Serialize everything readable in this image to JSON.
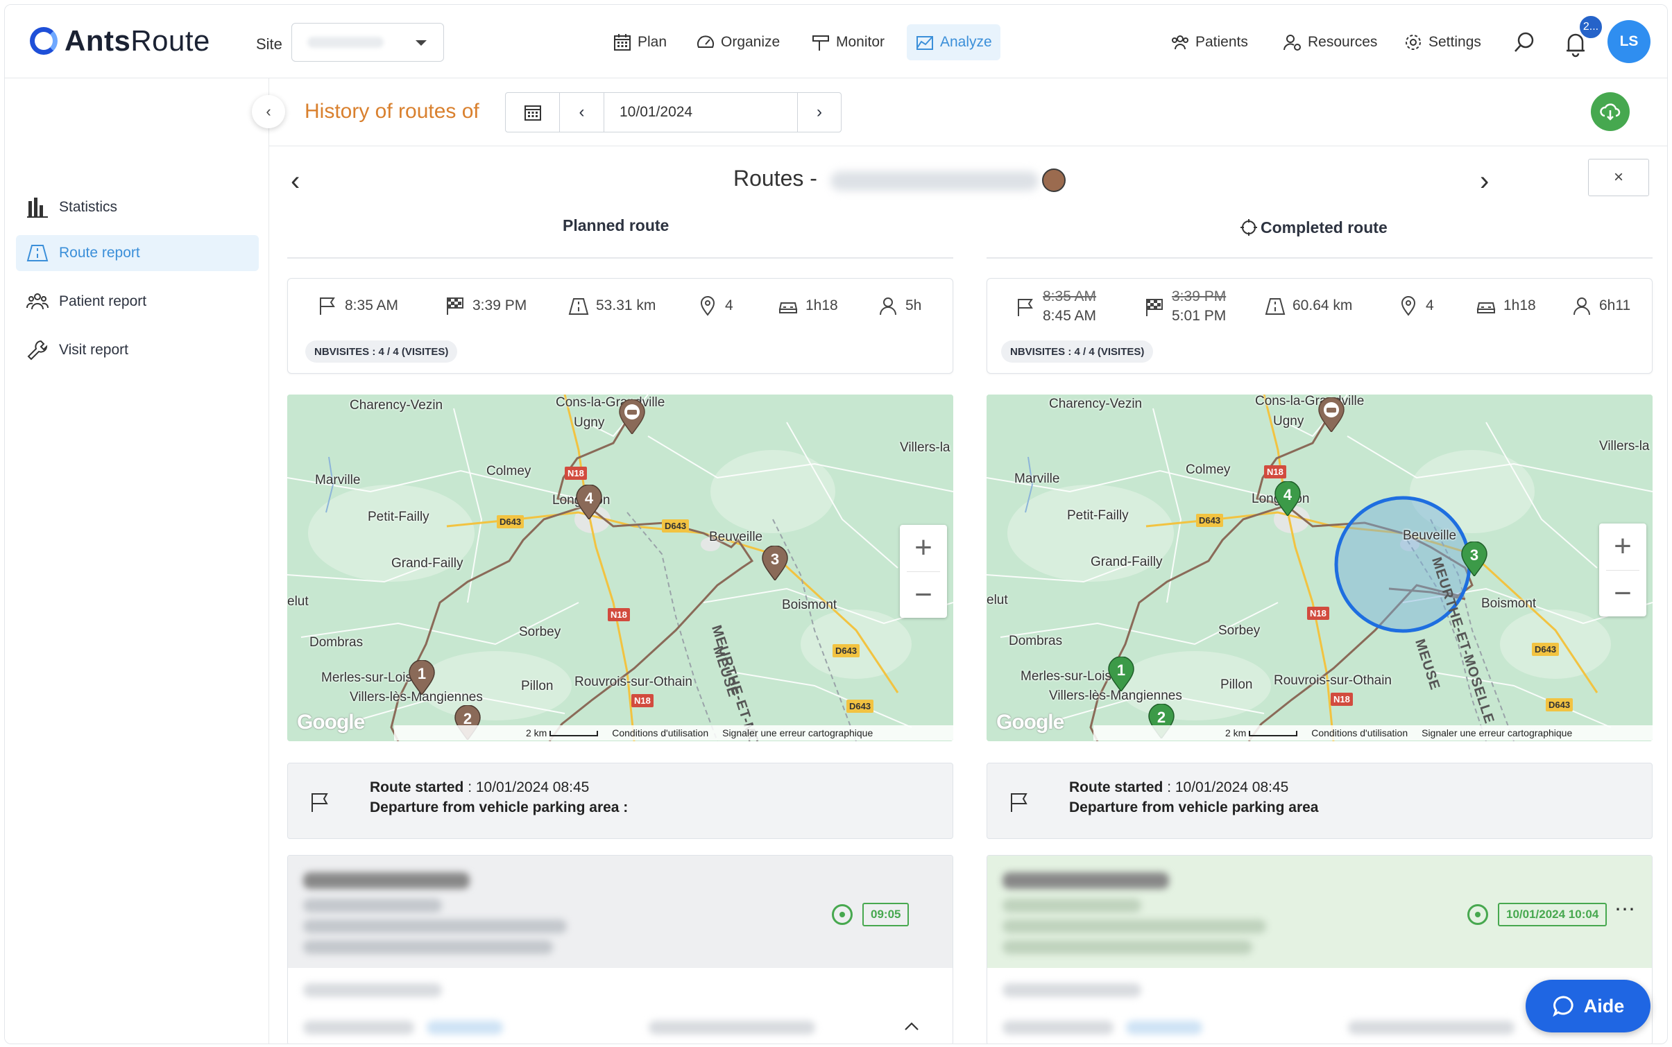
{
  "app": {
    "name_a": "Ants",
    "name_b": "Route"
  },
  "header": {
    "site_label": "Site",
    "site_value": "",
    "nav": [
      {
        "label": "Plan",
        "icon": "calendar-icon"
      },
      {
        "label": "Organize",
        "icon": "gauge-icon"
      },
      {
        "label": "Monitor",
        "icon": "signpost-icon"
      },
      {
        "label": "Analyze",
        "icon": "chart-area-icon",
        "active": true
      }
    ],
    "right_nav": [
      {
        "label": "Patients",
        "icon": "patients-icon"
      },
      {
        "label": "Resources",
        "icon": "resources-icon"
      },
      {
        "label": "Settings",
        "icon": "gear-icon"
      }
    ],
    "notifications_badge": "2...",
    "user_initials": "LS"
  },
  "sidebar": {
    "items": [
      {
        "label": "Statistics",
        "icon": "bar-chart-icon"
      },
      {
        "label": "Route report",
        "icon": "road-icon",
        "active": true
      },
      {
        "label": "Patient report",
        "icon": "people-icon"
      },
      {
        "label": "Visit report",
        "icon": "wrench-icon"
      }
    ]
  },
  "history": {
    "title": "History of routes of",
    "date": "10/01/2024"
  },
  "routes": {
    "title": "Routes -",
    "close": "×"
  },
  "planned": {
    "title": "Planned route",
    "start": "8:35 AM",
    "end": "3:39 PM",
    "distance": "53.31 km",
    "stops": "4",
    "drive": "1h18",
    "work": "5h",
    "badge": "NBVISITES : 4 / 4 (VISITES)"
  },
  "completed": {
    "title": "Completed route",
    "start_planned": "8:35 AM",
    "start": "8:45 AM",
    "end_planned": "3:39 PM",
    "end": "5:01 PM",
    "distance": "60.64 km",
    "stops": "4",
    "drive": "1h18",
    "work": "6h11",
    "badge": "NBVISITES : 4 / 4 (VISITES)"
  },
  "map": {
    "labels": [
      "Charency-Vezin",
      "Cons-la-Grandville",
      "Ugny",
      "Villers-la",
      "Colmey",
      "Marville",
      "Longuyon",
      "Petit-Failly",
      "Beuveille",
      "Grand-Failly",
      "Boismont",
      "elut",
      "Sorbey",
      "Dombras",
      "Merles-sur-Loison",
      "Villers-lès-Mangiennes",
      "Pillon",
      "Rouvrois-sur-Othain"
    ],
    "roads": [
      "N18",
      "D643"
    ],
    "departments": [
      "MEURTHE-ET-MOSELLE",
      "MEUSE"
    ],
    "google": "Google",
    "scale": "2 km",
    "terms": "Conditions d'utilisation",
    "report": "Signaler une erreur cartographique",
    "zoom_in": "+",
    "zoom_out": "−"
  },
  "started": {
    "label": "Route started",
    "planned_value": " : 10/01/2024 08:45",
    "completed_value": " : 10/01/2024 08:45",
    "departure_planned": "Departure from vehicle parking area :",
    "departure_completed": "Departure from vehicle parking area"
  },
  "visits": {
    "planned_time": "09:05",
    "completed_time": "10/01/2024 10:04",
    "more": "⋯"
  },
  "help": {
    "label": "Aide"
  },
  "colors": {
    "accent": "#3b8fd9",
    "orange": "#d9802e",
    "green": "#47a84f",
    "brown_pin": "#8a6a58",
    "green_pin": "#3c9a48",
    "blue_button": "#1f66e3"
  }
}
